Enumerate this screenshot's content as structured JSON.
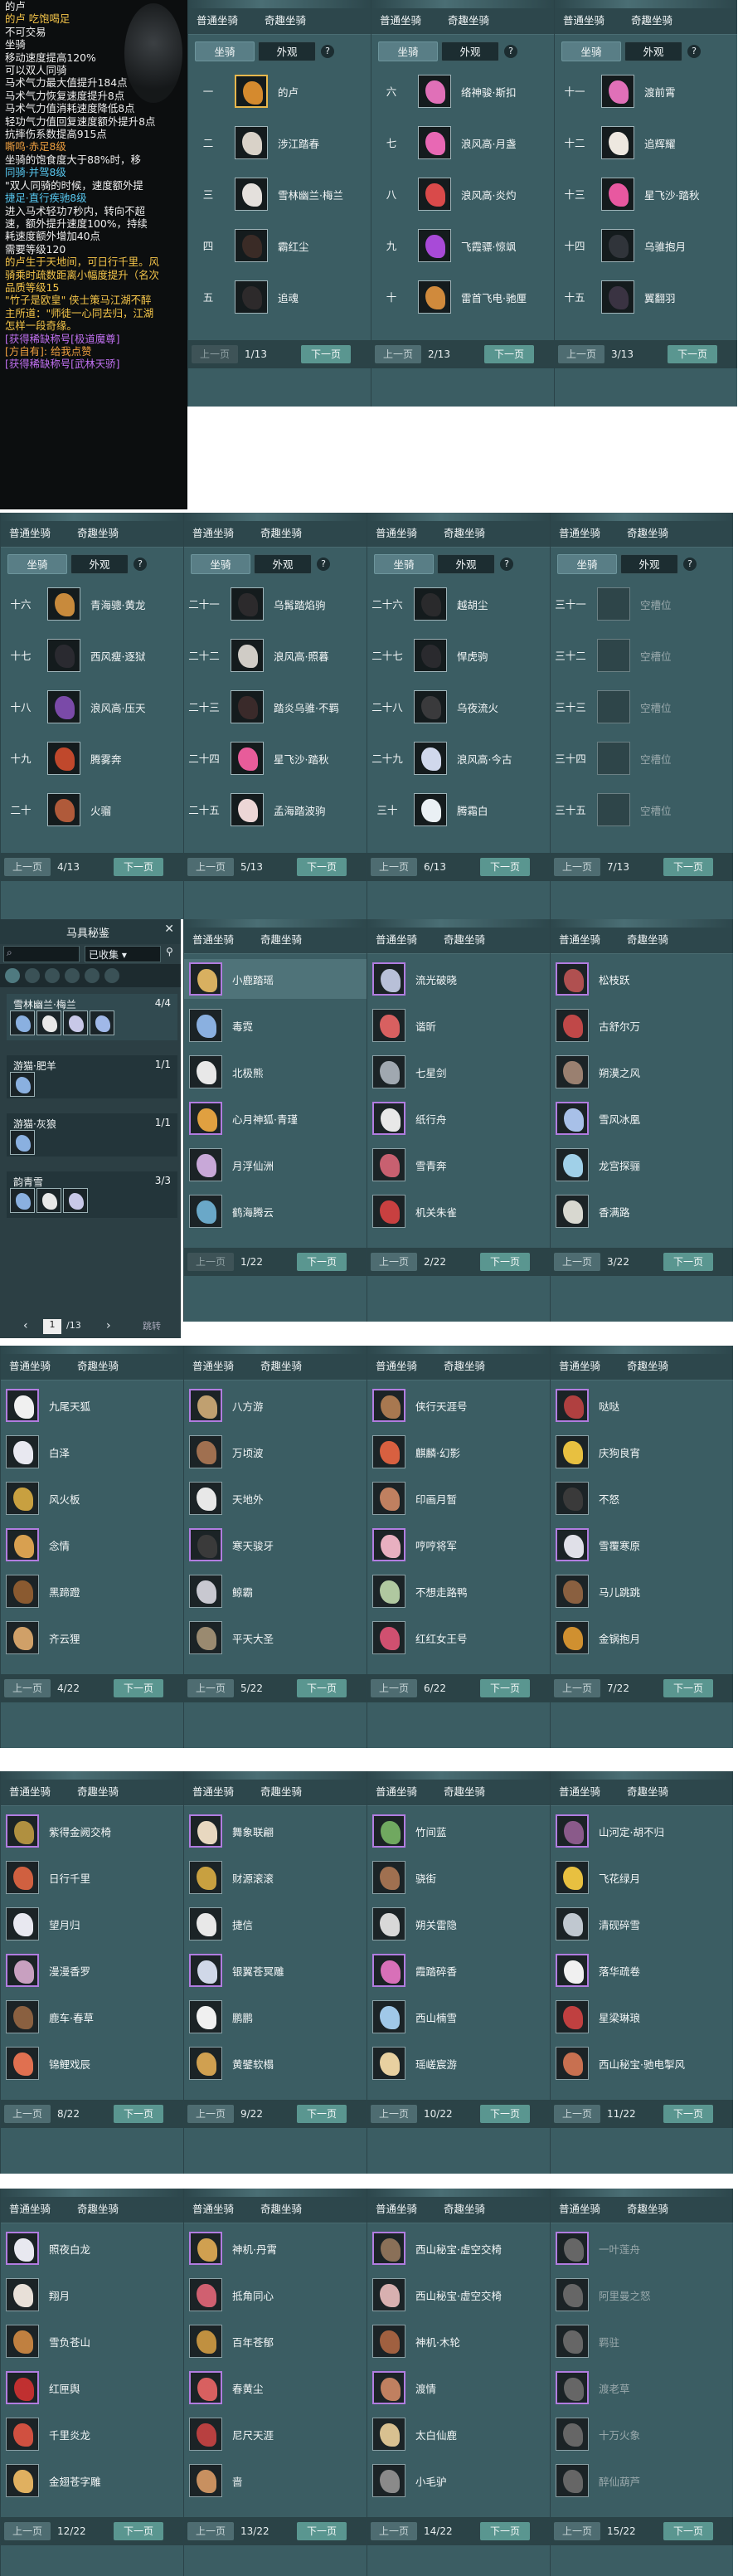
{
  "tooltip": {
    "lines": [
      {
        "t": "的卢",
        "c": "#f0f0f0"
      },
      {
        "t": "的卢   吃饱喝足",
        "c": "#f6c64a"
      },
      {
        "t": "不可交易",
        "c": "#f0f0f0"
      },
      {
        "t": "坐骑",
        "c": "#f0f0f0"
      },
      {
        "t": "移动速度提高120%",
        "c": "#f0f0f0"
      },
      {
        "t": "可以双人同骑",
        "c": "#f0f0f0"
      },
      {
        "t": "马术气力最大值提升184点",
        "c": "#f0f0f0"
      },
      {
        "t": "马术气力恢复速度提升8点",
        "c": "#f0f0f0"
      },
      {
        "t": "马术气力值消耗速度降低8点",
        "c": "#f0f0f0"
      },
      {
        "t": "轻功气力值回复速度额外提升8点",
        "c": "#f0f0f0"
      },
      {
        "t": "抗摔伤系数提高915点",
        "c": "#f0f0f0"
      },
      {
        "t": "   嘶鸣·赤足8级",
        "c": "#f0a040"
      },
      {
        "t": "坐骑的饱食度大于88%时，移",
        "c": "#f0f0f0"
      },
      {
        "t": "   同骑·并驾8级",
        "c": "#58c8f0"
      },
      {
        "t": "\"双人同骑的时候，速度额外提",
        "c": "#f0f0f0"
      },
      {
        "t": "   捷足·直行疾驰8级",
        "c": "#58c8f0"
      },
      {
        "t": "进入马术轻功7秒内，转向不超",
        "c": "#f0f0f0"
      },
      {
        "t": "速，额外提升速度100%，持续",
        "c": "#f0f0f0"
      },
      {
        "t": "耗速度额外增加40点",
        "c": "#f0f0f0"
      },
      {
        "t": "需要等级120",
        "c": "#f0f0f0"
      },
      {
        "t": "的卢生于天地间，可日行千里。风",
        "c": "#f6c64a"
      },
      {
        "t": "骑乘时疏数距离小幅度提升（名次",
        "c": "#f6c64a"
      },
      {
        "t": "品质等级15",
        "c": "#f6c64a"
      },
      {
        "t": "\"竹子是欧皇\" 侠士策马江湖不醉",
        "c": "#f6c64a"
      },
      {
        "t": "主所道：\"师徒一心同去归，江湖",
        "c": "#f6c64a"
      },
      {
        "t": "怎样一段奇缘。",
        "c": "#f6c64a"
      },
      {
        "t": "[获得稀缺称号[极道魔尊]",
        "c": "#c070f0"
      },
      {
        "t": "[方自有]:  给我点赞",
        "c": "#f0a040"
      },
      {
        "t": "[获得稀缺称号[武林天骄]",
        "c": "#c070f0"
      }
    ]
  },
  "tabs": {
    "normal": "普通坐骑",
    "special": "奇趣坐骑",
    "mount": "坐骑",
    "look": "外观",
    "help": "?"
  },
  "buttons": {
    "prev": "上一页",
    "next": "下一页",
    "jump": "跳转"
  },
  "mount_pages": [
    {
      "page": "1/13",
      "rows": [
        {
          "n": "一",
          "name": "的卢",
          "c": "#d58a2e",
          "sel": true
        },
        {
          "n": "二",
          "name": "涉江踏春",
          "c": "#d9d2c8"
        },
        {
          "n": "三",
          "name": "雪林幽兰·梅兰",
          "c": "#e4e0dc"
        },
        {
          "n": "四",
          "name": "霸红尘",
          "c": "#3a2b26"
        },
        {
          "n": "五",
          "name": "追魂",
          "c": "#2d2a2b"
        }
      ]
    },
    {
      "page": "2/13",
      "rows": [
        {
          "n": "六",
          "name": "络神骏·斯扣",
          "c": "#e070b8"
        },
        {
          "n": "七",
          "name": "浪风高·月盏",
          "c": "#e868b4"
        },
        {
          "n": "八",
          "name": "浪风高·炎灼",
          "c": "#d94a4a"
        },
        {
          "n": "九",
          "name": "飞霞骠·惊飒",
          "c": "#a84ad8"
        },
        {
          "n": "十",
          "name": "雷首飞电·驰厘",
          "c": "#d08a3c"
        }
      ]
    },
    {
      "page": "3/13",
      "rows": [
        {
          "n": "十一",
          "name": "渡前霄",
          "c": "#e070b8"
        },
        {
          "n": "十二",
          "name": "追辉耀",
          "c": "#eee8e0"
        },
        {
          "n": "十三",
          "name": "星飞沙·踏秋",
          "c": "#e858a0"
        },
        {
          "n": "十四",
          "name": "乌骓抱月",
          "c": "#30343a"
        },
        {
          "n": "十五",
          "name": "翼翻羽",
          "c": "#3a3342"
        }
      ]
    },
    {
      "page": "4/13",
      "rows": [
        {
          "n": "十六",
          "name": "青海骢·黄龙",
          "c": "#c88a3c"
        },
        {
          "n": "十七",
          "name": "西风瘦·逐狱",
          "c": "#2a2a30"
        },
        {
          "n": "十八",
          "name": "浪风高·压天",
          "c": "#7a4aa8"
        },
        {
          "n": "十九",
          "name": "腾雾奔",
          "c": "#c0482c"
        },
        {
          "n": "二十",
          "name": "火骝",
          "c": "#b05a3a"
        }
      ]
    },
    {
      "page": "5/13",
      "rows": [
        {
          "n": "二十一",
          "name": "乌髯踏焰驹",
          "c": "#2c2a2c"
        },
        {
          "n": "二十二",
          "name": "浪风高·照暮",
          "c": "#d0ccc6"
        },
        {
          "n": "二十三",
          "name": "踏炎乌骓·不羁",
          "c": "#3a2a2a"
        },
        {
          "n": "二十四",
          "name": "星飞沙·踏秋",
          "c": "#e85c9a"
        },
        {
          "n": "二十五",
          "name": "孟海踏波驹",
          "c": "#ecd6d6"
        }
      ]
    },
    {
      "page": "6/13",
      "rows": [
        {
          "n": "二十六",
          "name": "越胡尘",
          "c": "#2a2a2c"
        },
        {
          "n": "二十七",
          "name": "悍虎驹",
          "c": "#2a2a2e"
        },
        {
          "n": "二十八",
          "name": "乌夜流火",
          "c": "#3a3a3c"
        },
        {
          "n": "二十九",
          "name": "浪风高·今古",
          "c": "#d0d8ec"
        },
        {
          "n": "三十",
          "name": "腾霜白",
          "c": "#eaf0f4"
        }
      ]
    },
    {
      "page": "7/13",
      "rows": [
        {
          "n": "三十一",
          "name": "空槽位",
          "c": "",
          "empty": true
        },
        {
          "n": "三十二",
          "name": "空槽位",
          "c": "",
          "empty": true
        },
        {
          "n": "三十三",
          "name": "空槽位",
          "c": "",
          "empty": true
        },
        {
          "n": "三十四",
          "name": "空槽位",
          "c": "",
          "empty": true
        },
        {
          "n": "三十五",
          "name": "空槽位",
          "c": "",
          "empty": true
        }
      ]
    }
  ],
  "saddle": {
    "title": "马具秘鉴",
    "filter": "已收集",
    "page": "1",
    "total": "/13",
    "groups": [
      {
        "name": "雪林幽兰·梅兰",
        "count": "4/4",
        "n": 4
      },
      {
        "name": "游猫·肥羊",
        "count": "1/1",
        "n": 1
      },
      {
        "name": "游猫·灰狼",
        "count": "1/1",
        "n": 1
      },
      {
        "name": "韵青雪",
        "count": "3/3",
        "n": 3
      }
    ]
  },
  "item_pages": [
    {
      "page": "1/22",
      "items": [
        "小鹿踏瑶",
        "毒霓",
        "北极熊",
        "心月神狐·青瑾",
        "月浮仙洲",
        "鹤海腾云"
      ],
      "c": [
        "#d8b060",
        "#8ab0e0",
        "#e8e8e8",
        "#e0a040",
        "#c8a8d8",
        "#6aa8c8"
      ],
      "hl": [
        0
      ]
    },
    {
      "page": "2/22",
      "items": [
        "流光破晓",
        "谐昕",
        "七星剑",
        "纸行舟",
        "雪青奔",
        "机关朱雀"
      ],
      "c": [
        "#b8c0d8",
        "#d86060",
        "#a0a8b0",
        "#e8e8e8",
        "#c86070",
        "#c84040"
      ]
    },
    {
      "page": "3/22",
      "items": [
        "松枝跃",
        "古舒尔万",
        "朔漠之风",
        "雪风冰凰",
        "龙宫探骊",
        "香满路"
      ],
      "c": [
        "#b05050",
        "#c04848",
        "#9a8070",
        "#a8c0e8",
        "#a0d0e8",
        "#d8d8d0"
      ]
    },
    {
      "page": "4/22",
      "items": [
        "九尾天狐",
        "白泽",
        "风火板",
        "念情",
        "黑蹄蹬",
        "齐云狸"
      ],
      "c": [
        "#f0f0f0",
        "#e8e8f0",
        "#c8a040",
        "#d8a050",
        "#8a5a30",
        "#d0a068"
      ]
    },
    {
      "page": "5/22",
      "items": [
        "八方游",
        "万顷波",
        "天地外",
        "寒天骏牙",
        "鲸霸",
        "平天大圣"
      ],
      "c": [
        "#c0a070",
        "#a07050",
        "#e8e8e8",
        "#3a3a3a",
        "#c8c8d0",
        "#9a8a70"
      ]
    },
    {
      "page": "6/22",
      "items": [
        "侠行天涯号",
        "麒麟·幻影",
        "印画月暂",
        "哼哼将军",
        "不想走路鸭",
        "红红女王号"
      ],
      "c": [
        "#a87850",
        "#d86040",
        "#c08060",
        "#e8b0c0",
        "#b0c8a0",
        "#d05070"
      ]
    },
    {
      "page": "7/22",
      "items": [
        "哒哒",
        "庆狗良宵",
        "不怒",
        "雪覆寒原",
        "马儿跳跳",
        "金锅抱月"
      ],
      "c": [
        "#b04040",
        "#e8c040",
        "#3a3a3a",
        "#e0e0e8",
        "#8a6040",
        "#d09030"
      ]
    },
    {
      "page": "8/22",
      "items": [
        "紫得金阙交椅",
        "日行千里",
        "望月归",
        "漫漫香罗",
        "鹿车·春草",
        "锦鲤戏辰"
      ],
      "c": [
        "#b09040",
        "#d06040",
        "#e8e8f0",
        "#c8a0c0",
        "#8a6040",
        "#e07050"
      ]
    },
    {
      "page": "9/22",
      "items": [
        "舞象联翩",
        "财源滚滚",
        "捷信",
        "银翼苍冥雕",
        "鹏鹏",
        "黄鐾软榻"
      ],
      "c": [
        "#e8d8c0",
        "#c8a040",
        "#e8e8e8",
        "#d0d8e8",
        "#f0f0f0",
        "#d0a050"
      ]
    },
    {
      "page": "10/22",
      "items": [
        "竹间蓝",
        "骁街",
        "朔关雷隐",
        "霞踏碎香",
        "西山楠雪",
        "瑶嵯宸游"
      ],
      "c": [
        "#70a860",
        "#a07050",
        "#d8d8d8",
        "#d870b8",
        "#a0c8e8",
        "#e8d0a0"
      ]
    },
    {
      "page": "11/22",
      "items": [
        "山河定·胡不归",
        "飞花绿月",
        "清砚碎雪",
        "落华疏卷",
        "星梁琳琅",
        "西山秘宝·驰电掣风"
      ],
      "c": [
        "#8a5a8a",
        "#e8c040",
        "#c0c8d0",
        "#f0f0f0",
        "#c04040",
        "#c87050"
      ]
    },
    {
      "page": "12/22",
      "items": [
        "照夜白龙",
        "翔月",
        "雪负苍山",
        "红匣舆",
        "千里炎龙",
        "金翅苍字雕"
      ],
      "c": [
        "#e8e8f0",
        "#e8e0d8",
        "#c08040",
        "#c03030",
        "#d05040",
        "#e0b060"
      ]
    },
    {
      "page": "13/22",
      "items": [
        "神机·丹霄",
        "抵角同心",
        "百年苍郁",
        "春黄尘",
        "尼尺天涯",
        "啬"
      ],
      "c": [
        "#d0a050",
        "#d06070",
        "#c09040",
        "#d86060",
        "#b84040",
        "#c89060"
      ]
    },
    {
      "page": "14/22",
      "items": [
        "西山秘宝·虚空交椅",
        "西山秘宝·虚空交椅",
        "神机·木轮",
        "渡情",
        "太白仙鹿",
        "小毛驴"
      ],
      "c": [
        "#8a7058",
        "#d8b0b0",
        "#a06040",
        "#c08060",
        "#d8c090",
        "#8a8a8a"
      ]
    },
    {
      "page": "15/22",
      "items": [
        "一叶莲舟",
        "阿里曼之怒",
        "羁驻",
        "渡老草",
        "十万火象",
        "醉仙葫芦"
      ],
      "c": [
        "#666",
        "#666",
        "#666",
        "#666",
        "#666",
        "#666"
      ],
      "dim": true
    }
  ]
}
